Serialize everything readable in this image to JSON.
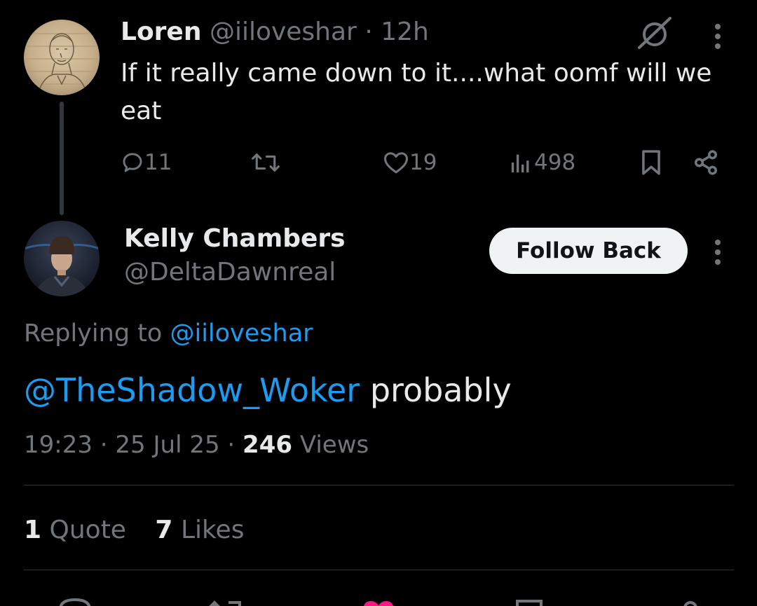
{
  "parent_tweet": {
    "author_name": "Loren",
    "handle": "@iiloveshar",
    "separator": "·",
    "time": "12h",
    "text": "If it really came down to it....what oomf will we eat",
    "actions": {
      "replies": "11",
      "retweets": "",
      "likes": "19",
      "views": "498"
    },
    "icons": [
      "grok-icon",
      "more-icon",
      "reply-icon",
      "retweet-icon",
      "like-icon",
      "views-icon",
      "bookmark-icon",
      "share-icon"
    ]
  },
  "reply_tweet": {
    "author_name": "Kelly Chambers",
    "handle": "@DeltaDawnreal",
    "follow_label": "Follow Back",
    "replying_prefix": "Replying to",
    "replying_to": "@iiloveshar",
    "mention": "@TheShadow_Woker",
    "text": " probably",
    "time": "19:23",
    "date": "25 Jul 25",
    "separator": "·",
    "views_count": "246",
    "views_label": "Views"
  },
  "stats": {
    "quote_count": "1",
    "quote_label": "Quote",
    "likes_count": "7",
    "likes_label": "Likes"
  },
  "colors": {
    "background": "#000000",
    "text": "#e7e9ea",
    "muted": "#71767b",
    "link": "#1d9bf0",
    "like_pink": "#f91880"
  }
}
